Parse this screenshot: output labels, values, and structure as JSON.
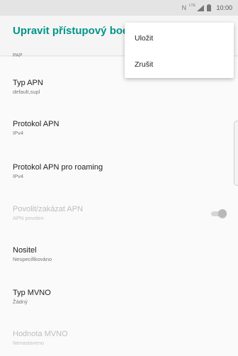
{
  "status_bar": {
    "network_icon": "nfc-icon",
    "signal_label": "LTE",
    "time": "10:00"
  },
  "app_bar": {
    "title": "Upravit přístupový bod"
  },
  "list": {
    "cut_summary": "PAP",
    "items": [
      {
        "title": "Typ APN",
        "summary": "default,supl",
        "enabled": true
      },
      {
        "title": "Protokol APN",
        "summary": "IPv4",
        "enabled": true
      },
      {
        "title": "Protokol APN pro roaming",
        "summary": "IPv4",
        "enabled": true
      },
      {
        "title": "Povolit/zakázat APN",
        "summary": "APN povolen",
        "enabled": false,
        "toggle": true
      },
      {
        "title": "Nositel",
        "summary": "Nespecifikováno",
        "enabled": true
      },
      {
        "title": "Typ MVNO",
        "summary": "Žádný",
        "enabled": true
      },
      {
        "title": "Hodnota MVNO",
        "summary": "Nenastaveno",
        "enabled": false
      }
    ]
  },
  "menu": {
    "save_label": "Uložit",
    "cancel_label": "Zrušit"
  },
  "colors": {
    "accent": "#009688",
    "status_bar": "#e4e4e4",
    "disabled_text": "#bdbdbd"
  }
}
